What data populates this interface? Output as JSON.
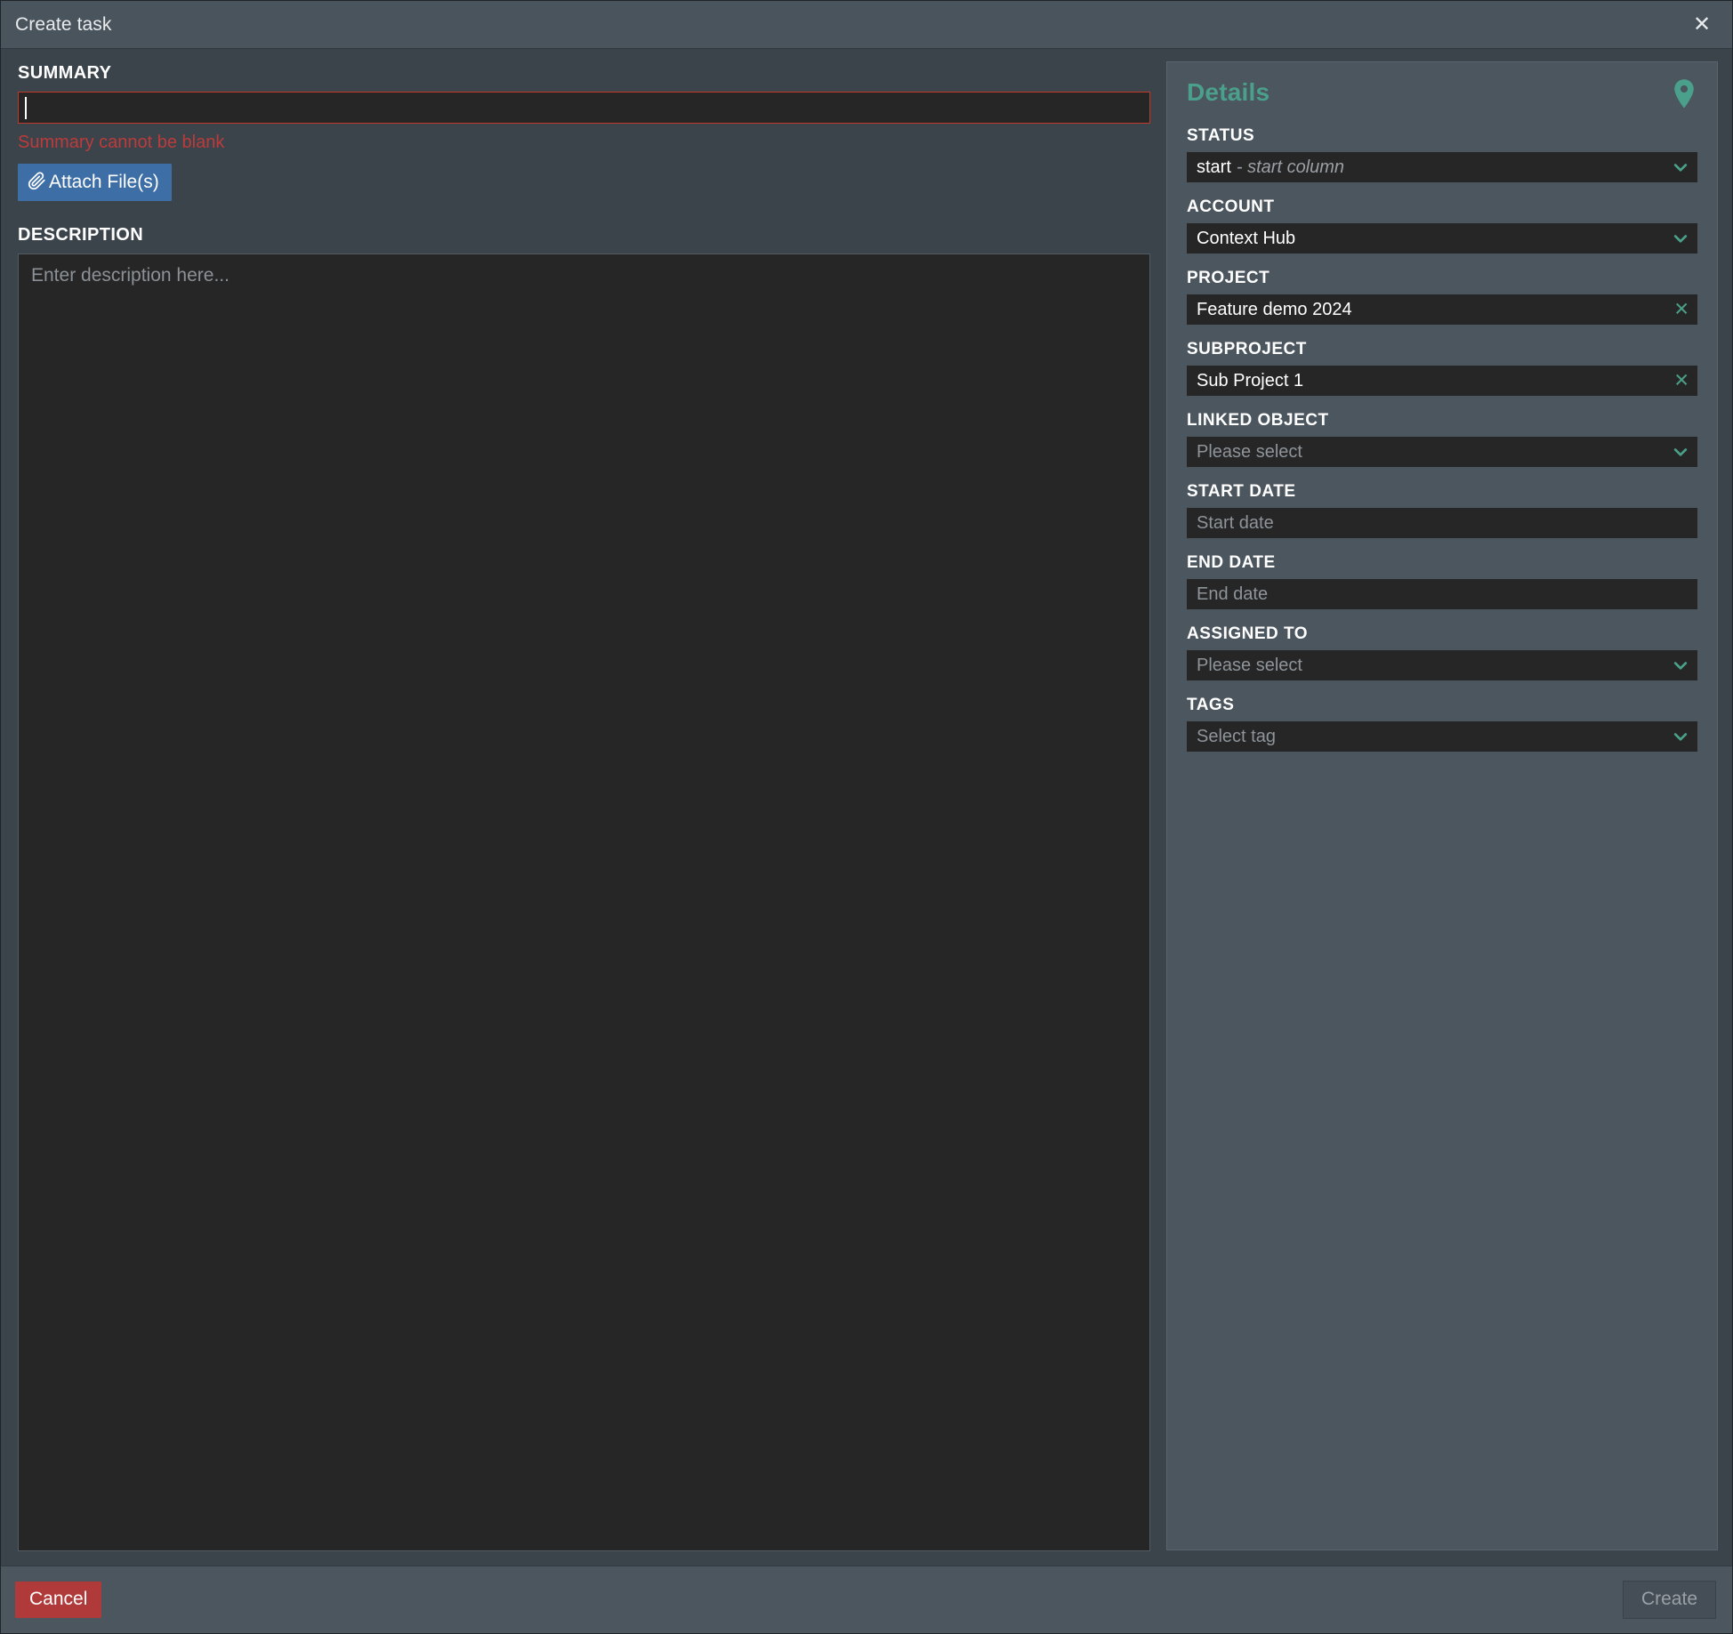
{
  "window": {
    "title": "Create task",
    "close_icon": "close-icon",
    "close_glyph": "✕"
  },
  "left": {
    "summary": {
      "label": "SUMMARY",
      "value": "",
      "placeholder": "",
      "error": "Summary cannot be blank"
    },
    "attach": {
      "label": "Attach File(s)",
      "icon": "paperclip-icon",
      "icon_glyph": "📎",
      "color": "#3d6ea5"
    },
    "description": {
      "label": "DESCRIPTION",
      "value": "",
      "placeholder": "Enter description here..."
    }
  },
  "details": {
    "title": "Details",
    "accent_color": "#4aa08a",
    "pin_icon": "location-pin-icon",
    "fields": [
      {
        "label": "STATUS",
        "name": "status",
        "value": "start",
        "sub_value": "- start column",
        "icon": "chevron-down-icon",
        "icon_type": "chevron",
        "muted": false
      },
      {
        "label": "ACCOUNT",
        "name": "account",
        "value": "Context Hub",
        "sub_value": "",
        "icon": "chevron-down-icon",
        "icon_type": "chevron",
        "muted": false
      },
      {
        "label": "PROJECT",
        "name": "project",
        "value": "Feature demo 2024",
        "sub_value": "",
        "icon": "clear-x-icon",
        "icon_type": "x",
        "icon_glyph": "✕",
        "muted": false
      },
      {
        "label": "SUBPROJECT",
        "name": "subproject",
        "value": "Sub Project 1",
        "sub_value": "",
        "icon": "clear-x-icon",
        "icon_type": "x",
        "icon_glyph": "✕",
        "muted": false
      },
      {
        "label": "LINKED OBJECT",
        "name": "linked-object",
        "value": "Please select",
        "sub_value": "",
        "icon": "chevron-down-icon",
        "icon_type": "chevron",
        "muted": true
      },
      {
        "label": "START DATE",
        "name": "start-date",
        "value": "Start date",
        "sub_value": "",
        "icon": "",
        "icon_type": "none",
        "muted": true
      },
      {
        "label": "END DATE",
        "name": "end-date",
        "value": "End date",
        "sub_value": "",
        "icon": "",
        "icon_type": "none",
        "muted": true
      },
      {
        "label": "ASSIGNED TO",
        "name": "assigned-to",
        "value": "Please select",
        "sub_value": "",
        "icon": "chevron-down-icon",
        "icon_type": "chevron",
        "muted": true
      },
      {
        "label": "TAGS",
        "name": "tags",
        "value": "Select tag",
        "sub_value": "",
        "icon": "chevron-down-icon",
        "icon_type": "chevron",
        "muted": true
      }
    ]
  },
  "footer": {
    "cancel_label": "Cancel",
    "cancel_color": "#b03a3a",
    "create_label": "Create",
    "create_disabled": true
  }
}
